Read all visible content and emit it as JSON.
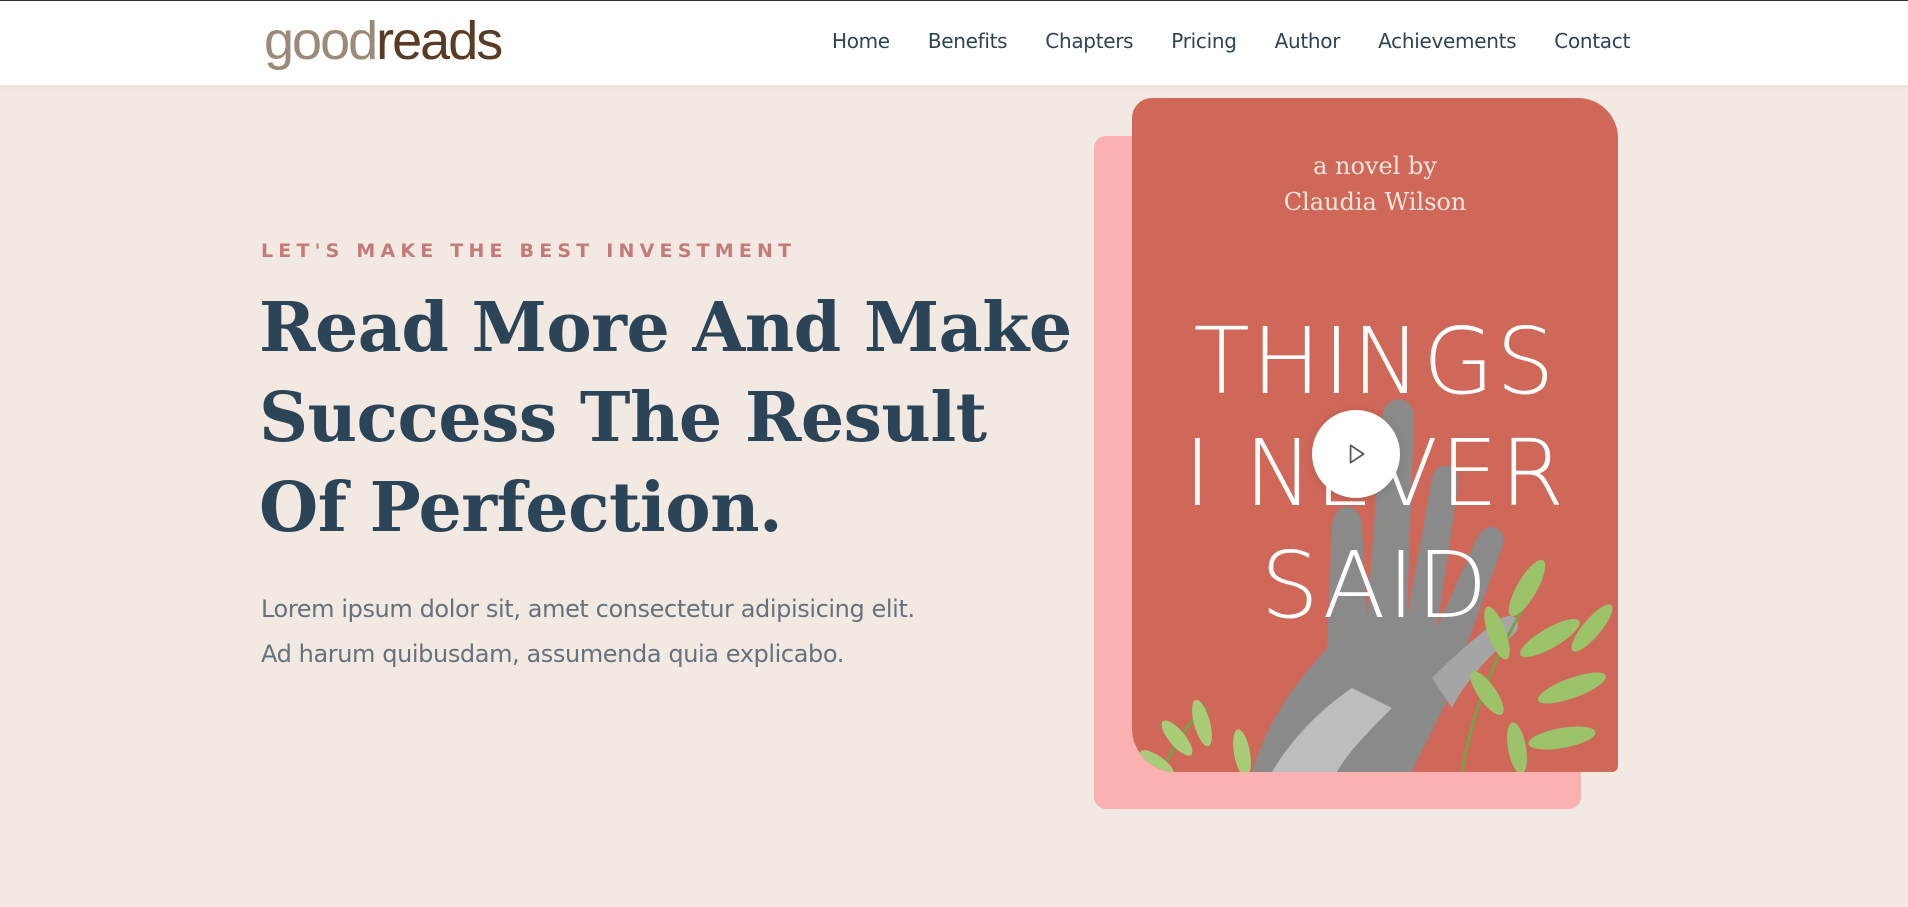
{
  "logo": {
    "good": "good",
    "reads": "reads"
  },
  "nav": [
    {
      "label": "Home"
    },
    {
      "label": "Benefits"
    },
    {
      "label": "Chapters"
    },
    {
      "label": "Pricing"
    },
    {
      "label": "Author"
    },
    {
      "label": "Achievements"
    },
    {
      "label": "Contact"
    }
  ],
  "hero": {
    "eyebrow": "LET'S MAKE THE BEST INVESTMENT",
    "headline_lines": [
      "Read More And Make",
      "Success The Result",
      "Of Perfection."
    ],
    "lead_lines": [
      "Lorem ipsum dolor sit, amet consectetur adipisicing elit.",
      "Ad harum quibusdam, assumenda quia explicabo."
    ]
  },
  "book": {
    "byline_lines": [
      "a novel by",
      "Claudia Wilson"
    ],
    "title_lines": [
      "THINGS",
      "I NEVER",
      "SAID"
    ]
  },
  "icons": {
    "play": "play-icon"
  },
  "colors": {
    "background": "#f3e9e3",
    "accent": "#c47a7b",
    "heading": "#2c4457",
    "book_cover": "#cf6858",
    "book_shadow": "#fbb0b2"
  }
}
